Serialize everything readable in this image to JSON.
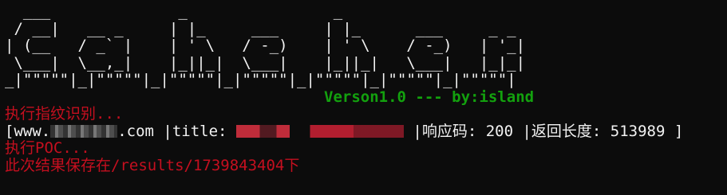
{
  "banner_lines": [
    "  ___              _                _",
    " / __|   __ _     | |_     ___     | |_      ___     _ _",
    "| (__   / _` |    | ' \\   / -_)    | ' \\    / -_)   | '_|",
    " \\___|  \\__,_|    |_||_|  \\___|    |_||_|   \\___|   |_|_|",
    "_|\"\"\"\"\"|_|\"\"\"\"\"|_|\"\"\"\"\"|_|\"\"\"\"\"|_|\"\"\"\"\"|_|\"\"\"\"\"|_|\"\"\"\"\"|"
  ],
  "version_line": "Verson1.0 --- by:island",
  "status_fingerprint": "执行指纹识别...",
  "result": {
    "open_bracket": "[",
    "domain_prefix": "www.",
    "domain_suffix": ".com",
    "title_label": " |title: ",
    "status_label": " |响应码: 200",
    "length_label": " |返回长度: 513989 ]"
  },
  "status_poc": "执行POC...",
  "status_saved": "此次结果保存在/results/1739843404下",
  "colors": {
    "background": "#0c0c0c",
    "banner": "#f2f2f2",
    "version": "#13a10e",
    "status": "#c50f1f",
    "text": "#f2f2f2"
  }
}
